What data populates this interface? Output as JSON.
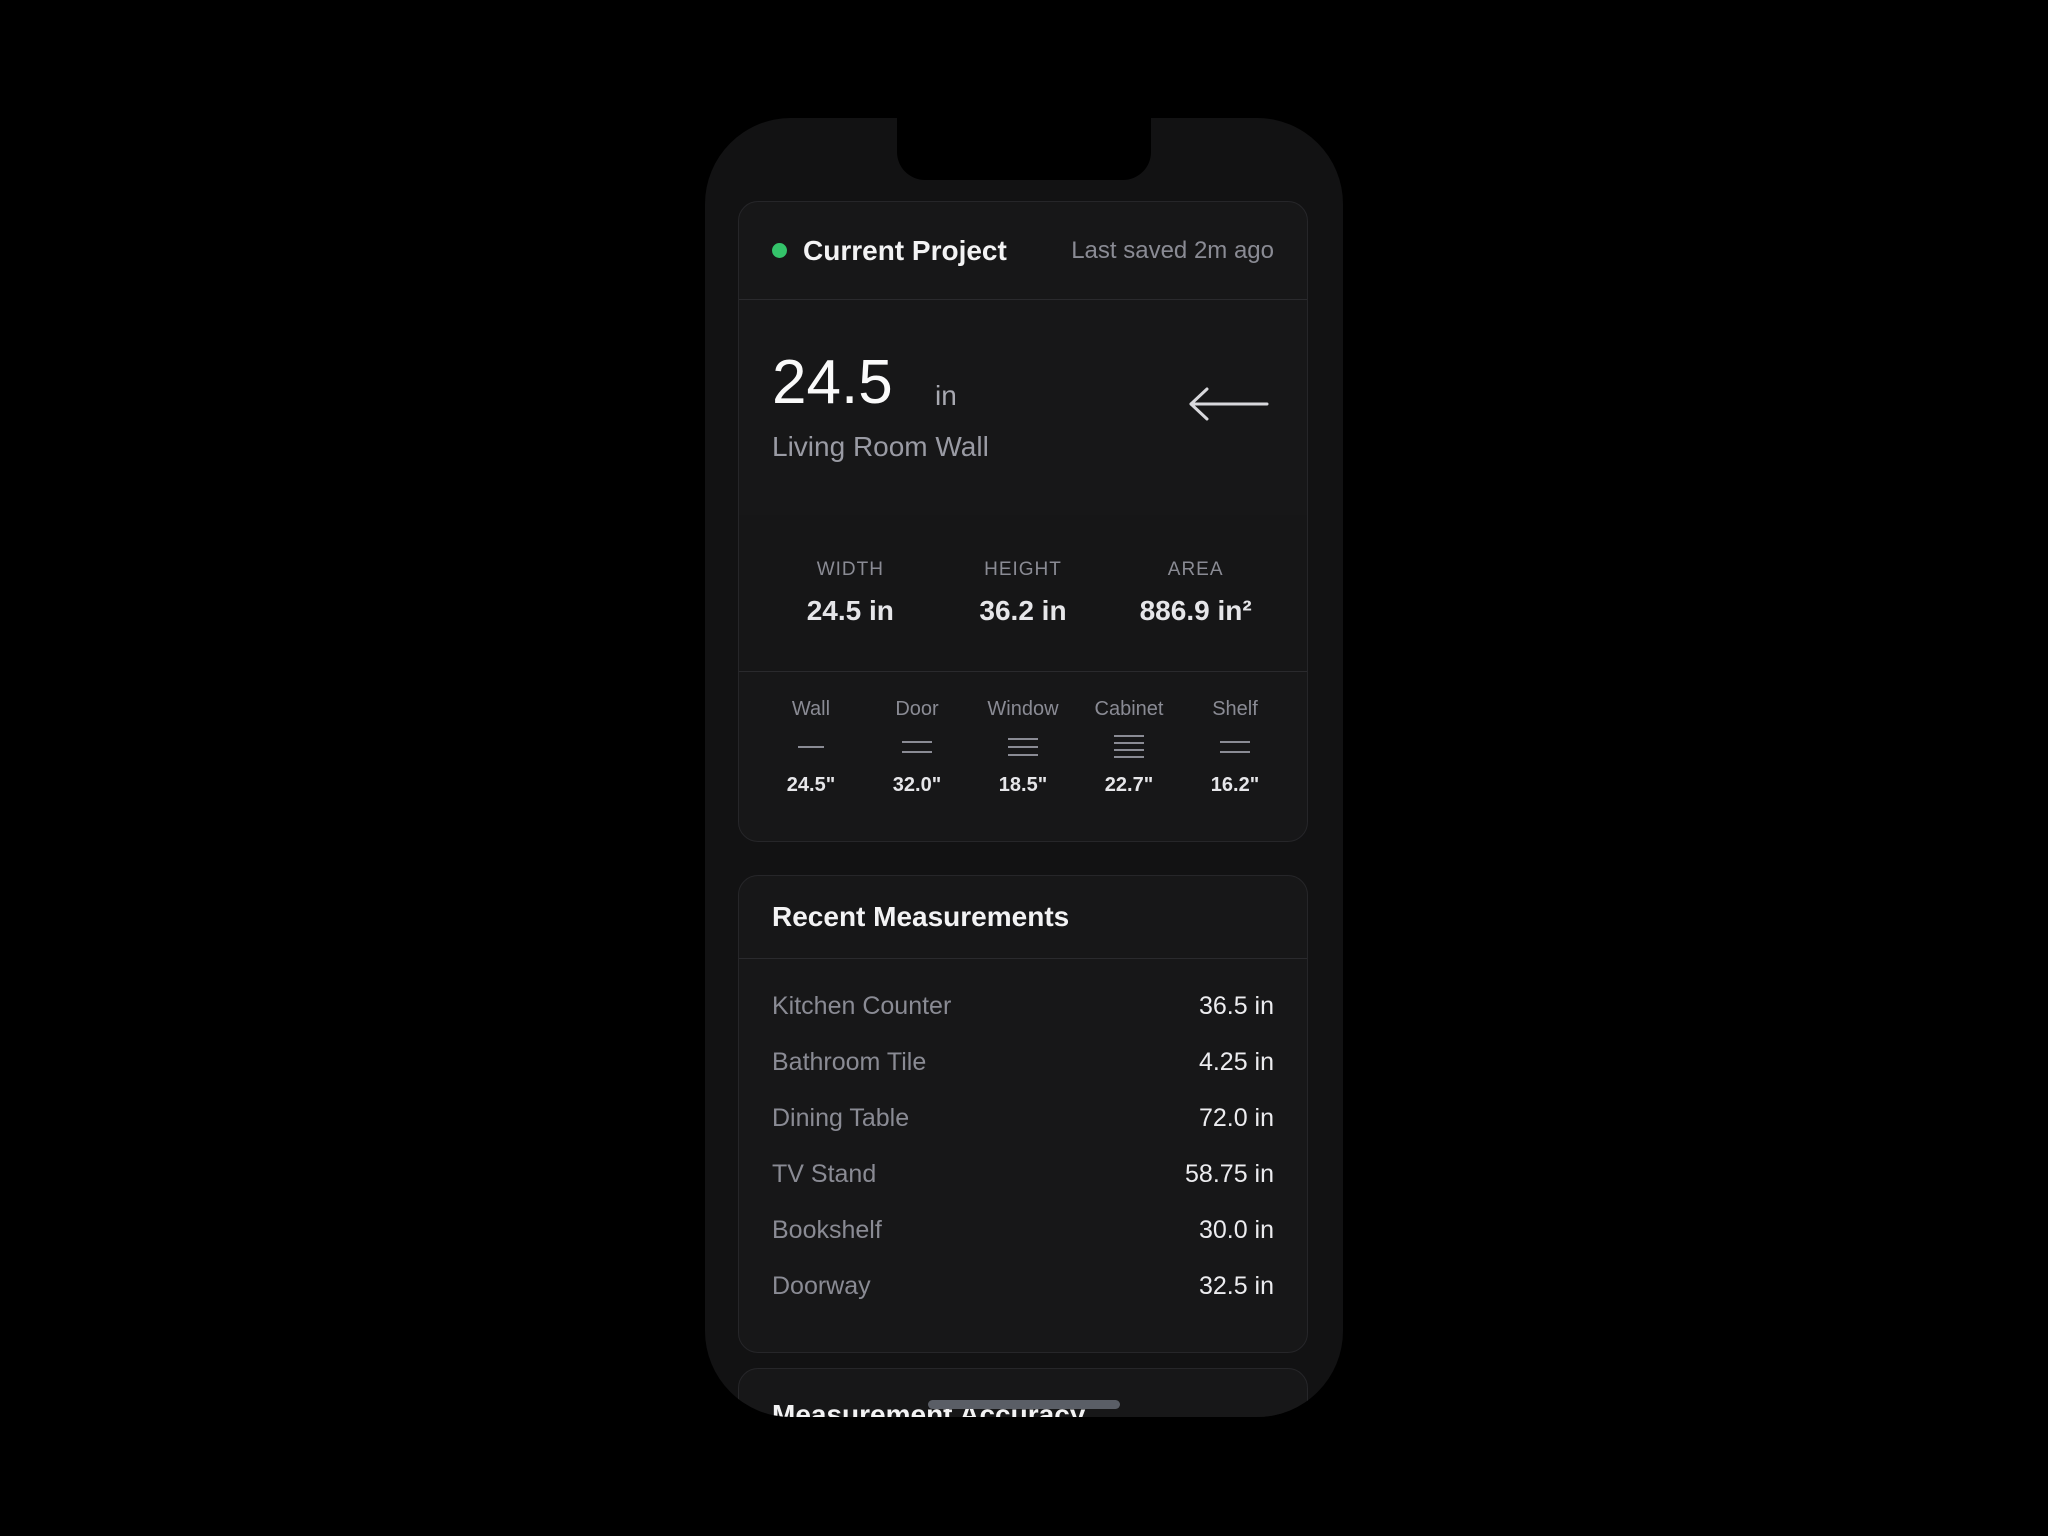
{
  "project": {
    "title": "Current Project",
    "saved": "Last saved 2m ago",
    "status_color": "#34c36a"
  },
  "current": {
    "value": "24.5",
    "unit": "in",
    "name": "Living Room Wall",
    "direction_icon": "arrow-left-icon"
  },
  "dimensions": [
    {
      "label": "WIDTH",
      "value": "24.5 in"
    },
    {
      "label": "HEIGHT",
      "value": "36.2 in"
    },
    {
      "label": "AREA",
      "value": "886.9 in²"
    }
  ],
  "types": [
    {
      "label": "Wall",
      "value": "24.5\"",
      "icon": "one-line-icon"
    },
    {
      "label": "Door",
      "value": "32.0\"",
      "icon": "two-lines-icon"
    },
    {
      "label": "Window",
      "value": "18.5\"",
      "icon": "three-lines-icon"
    },
    {
      "label": "Cabinet",
      "value": "22.7\"",
      "icon": "four-lines-icon"
    },
    {
      "label": "Shelf",
      "value": "16.2\"",
      "icon": "two-lines-icon"
    }
  ],
  "recent": {
    "title": "Recent Measurements",
    "items": [
      {
        "name": "Kitchen Counter",
        "value": "36.5 in"
      },
      {
        "name": "Bathroom Tile",
        "value": "4.25 in"
      },
      {
        "name": "Dining Table",
        "value": "72.0 in"
      },
      {
        "name": "TV Stand",
        "value": "58.75 in"
      },
      {
        "name": "Bookshelf",
        "value": "30.0 in"
      },
      {
        "name": "Doorway",
        "value": "32.5 in"
      }
    ]
  },
  "accuracy": {
    "title": "Measurement Accuracy"
  }
}
